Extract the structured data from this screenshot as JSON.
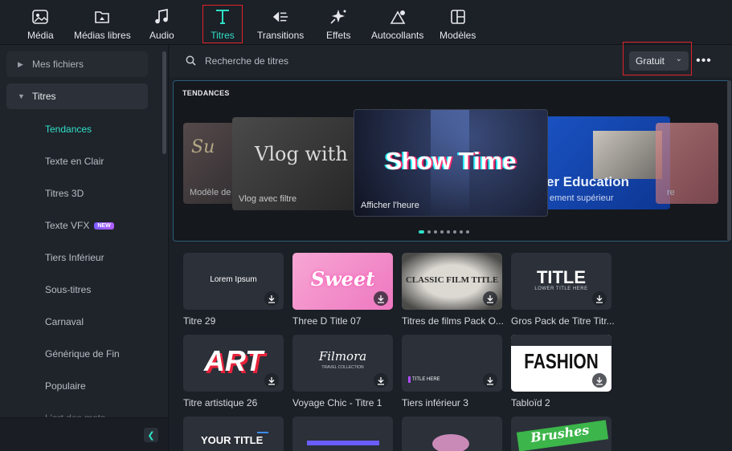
{
  "toolbar": {
    "tabs": [
      {
        "label": "Média",
        "icon": "media-icon"
      },
      {
        "label": "Médias libres",
        "icon": "free-media-icon"
      },
      {
        "label": "Audio",
        "icon": "music-note-icon"
      },
      {
        "label": "Titres",
        "icon": "text-t-icon",
        "active": true
      },
      {
        "label": "Transitions",
        "icon": "transitions-icon"
      },
      {
        "label": "Effets",
        "icon": "effects-sparkle-icon"
      },
      {
        "label": "Autocollants",
        "icon": "sticker-icon"
      },
      {
        "label": "Modèles",
        "icon": "templates-icon"
      }
    ]
  },
  "sidebar": {
    "my_files": "Mes fichiers",
    "titles": "Titres",
    "items": [
      {
        "label": "Tendances",
        "active": true
      },
      {
        "label": "Texte en Clair"
      },
      {
        "label": "Titres 3D"
      },
      {
        "label": "Texte VFX",
        "badge": "NEW"
      },
      {
        "label": "Tiers Inférieur"
      },
      {
        "label": "Sous-titres"
      },
      {
        "label": "Carnaval"
      },
      {
        "label": "Générique de Fin"
      },
      {
        "label": "Populaire"
      },
      {
        "label": "L'art des mots"
      }
    ]
  },
  "search": {
    "placeholder": "Recherche de titres"
  },
  "filter": {
    "selected": "Gratuit"
  },
  "trending": {
    "heading": "TENDANCES",
    "cards": [
      {
        "caption": "Modèle de"
      },
      {
        "caption": "Vlog avec filtre",
        "art_text": "Vlog with Fil"
      },
      {
        "caption": "Afficher l'heure",
        "art_text": "Show Time"
      },
      {
        "caption": "ement supérieur",
        "art_text": "er Education"
      },
      {
        "caption": "re"
      }
    ],
    "dots": 8
  },
  "grid": [
    {
      "name": "Titre 29",
      "art": "Lorem Ipsum"
    },
    {
      "name": "Three D Title 07",
      "art": "Sweet"
    },
    {
      "name": "Titres de films Pack O...",
      "art": "CLASSIC FILM TITLE"
    },
    {
      "name": "Gros Pack de Titre Titr...",
      "art": "TITLE",
      "art_sub": "LOWER TITLE HERE"
    },
    {
      "name": "Titre artistique 26",
      "art": "ART"
    },
    {
      "name": "Voyage Chic - Titre 1",
      "art": "Filmora",
      "art_sub": "TRAVEL COLLECTION"
    },
    {
      "name": "Tiers inférieur 3",
      "art": "TITLE HERE"
    },
    {
      "name": "Tabloïd 2",
      "art": "FASHION"
    },
    {
      "name": "",
      "art": "YOUR TITLE"
    },
    {
      "name": "",
      "art": ""
    },
    {
      "name": "",
      "art": ""
    },
    {
      "name": "",
      "art": "Brushes"
    }
  ],
  "colors": {
    "accent": "#2fe0c7",
    "highlight_box": "#e0242a"
  }
}
